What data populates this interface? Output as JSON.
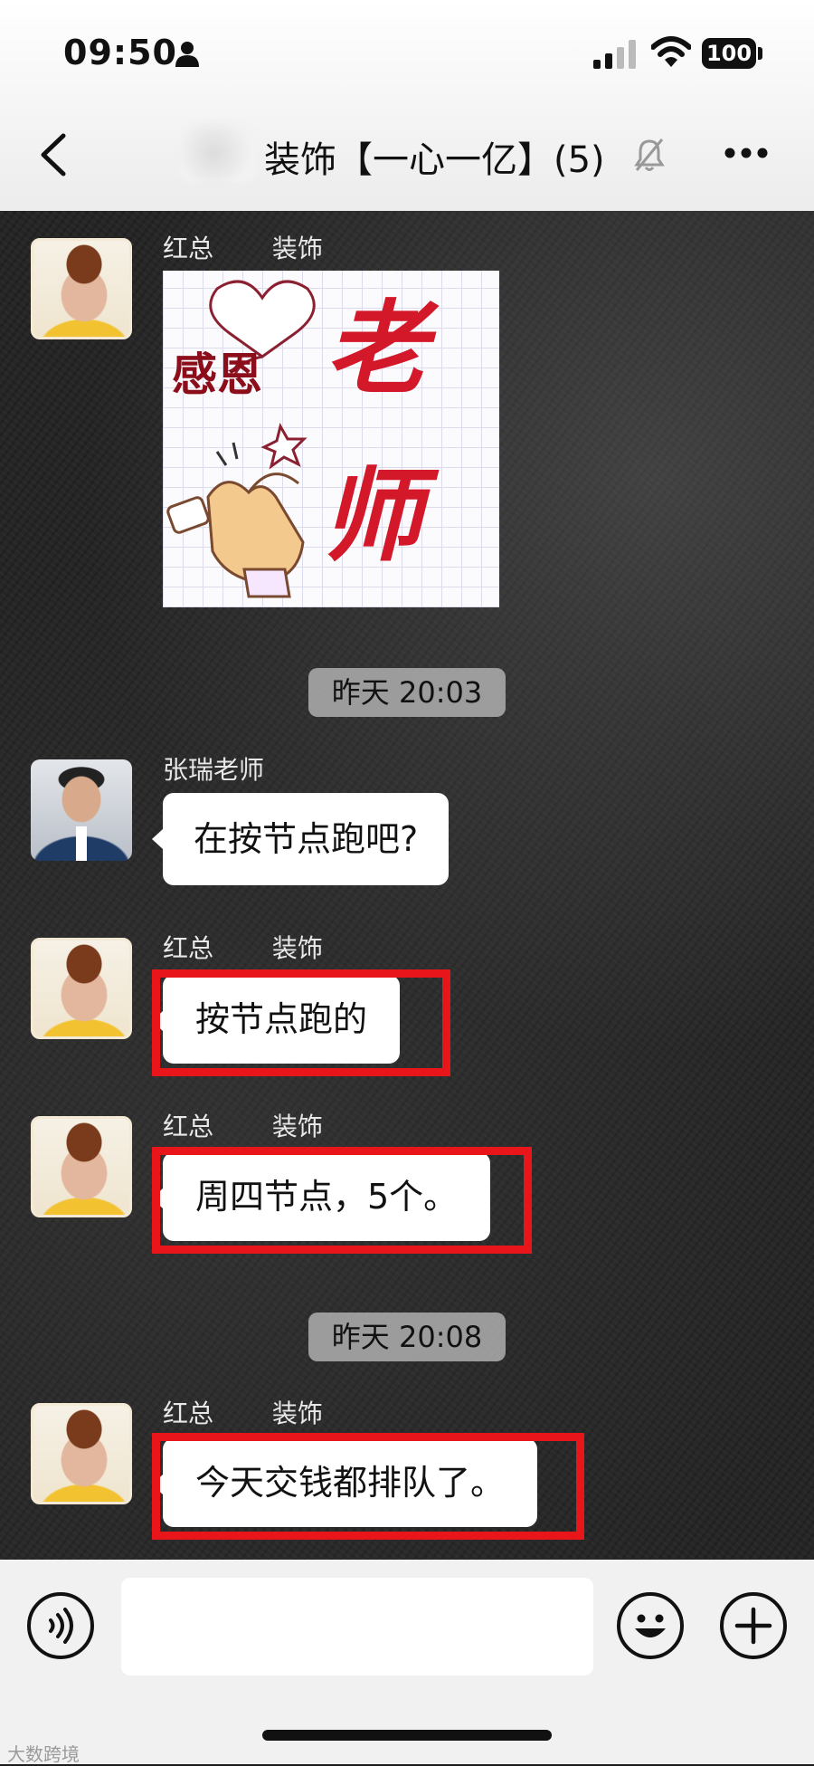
{
  "status_bar": {
    "time": "09:50",
    "battery": "100",
    "icons": [
      "person-icon",
      "signal-icon",
      "wifi-icon",
      "battery-icon"
    ]
  },
  "nav": {
    "title": "装饰【一心一亿】(5)",
    "icons": [
      "back-icon",
      "mute-bell-icon",
      "more-icon"
    ]
  },
  "sticker": {
    "line1": "感恩",
    "line2a": "老",
    "line2b": "师"
  },
  "messages": [
    {
      "sender": "红总 　　装饰",
      "type": "sticker"
    },
    {
      "time": "昨天 20:03"
    },
    {
      "sender": "张瑞老师",
      "text": "在按节点跑吧?"
    },
    {
      "sender": "红总 　　装饰",
      "text": "按节点跑的"
    },
    {
      "sender": "红总 　　装饰",
      "text": "周四节点，5个。"
    },
    {
      "time": "昨天 20:08"
    },
    {
      "sender": "红总 　　装饰",
      "text": "今天交钱都排队了。"
    }
  ],
  "input": {
    "placeholder": ""
  },
  "bottom_icons": [
    "voice-icon",
    "emoji-icon",
    "plus-icon"
  ],
  "watermark": "大数跨境",
  "colors": {
    "highlight": "#e8161b",
    "bubble": "#ffffff"
  }
}
